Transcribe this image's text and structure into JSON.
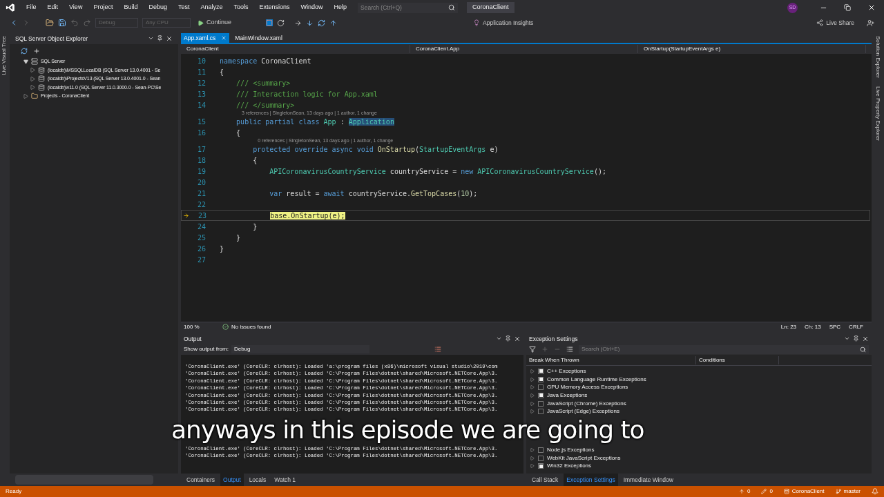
{
  "menu": [
    "File",
    "Edit",
    "View",
    "Project",
    "Build",
    "Debug",
    "Test",
    "Analyze",
    "Tools",
    "Extensions",
    "Window",
    "Help"
  ],
  "search": {
    "placeholder": "Search (Ctrl+Q)"
  },
  "solution_name": "CoronaClient",
  "avatar": "SD",
  "toolbar": {
    "configuration": "Debug",
    "platform": "Any CPU",
    "continue": "Continue",
    "insights": "Application Insights",
    "live_share": "Live Share"
  },
  "left_vertical_tab": "Live Visual Tree",
  "right_vertical_tabs": [
    "Solution Explorer",
    "Live Property Explorer"
  ],
  "sql_explorer": {
    "title": "SQL Server Object Explorer",
    "tree": [
      {
        "label": "SQL Server",
        "kind": "server",
        "expanded": true,
        "children": [
          {
            "label": "(localdb)\\MSSQLLocalDB (SQL Server 13.0.4001 - Se",
            "kind": "db",
            "expanded": false
          },
          {
            "label": "(localdb)\\ProjectsV13 (SQL Server 13.0.4001.0 - Sean",
            "kind": "db",
            "expanded": false
          },
          {
            "label": "(localdb)\\v11.0 (SQL Server 11.0.3000.0 - Sean-PC\\Se",
            "kind": "db",
            "expanded": false
          }
        ]
      },
      {
        "label": "Projects - CoronaClient",
        "kind": "folder",
        "expanded": false
      }
    ]
  },
  "editor_tabs": [
    {
      "label": "App.xaml.cs",
      "selected": true
    },
    {
      "label": "MainWindow.xaml",
      "selected": false
    }
  ],
  "nav_bar": [
    "CoronaClient",
    "CoronaClient.App",
    "OnStartup(StartupEventArgs e)"
  ],
  "code_lines": [
    {
      "number": "10",
      "tokens": [
        {
          "text": "namespace",
          "kind": "keyword"
        },
        {
          "text": " CoronaClient",
          "kind": "plain"
        }
      ]
    },
    {
      "number": "11",
      "tokens": [
        {
          "text": "{",
          "kind": "plain"
        }
      ]
    },
    {
      "number": "12",
      "tokens": [
        {
          "text": "    /// <summary>",
          "kind": "comment"
        }
      ]
    },
    {
      "number": "13",
      "tokens": [
        {
          "text": "    /// Interaction logic for App.xaml",
          "kind": "comment"
        }
      ]
    },
    {
      "number": "14",
      "tokens": [
        {
          "text": "    /// </summary>",
          "kind": "comment"
        }
      ]
    },
    {
      "number": "15",
      "lens": "3 references | SingletonSean, 13 days ago | 1 author, 1 change",
      "tokens": [
        {
          "text": "    public partial class",
          "kind": "keyword"
        },
        {
          "text": " App",
          "kind": "type"
        },
        {
          "text": " : ",
          "kind": "plain"
        },
        {
          "text": "Application",
          "kind": "type_highlight"
        }
      ]
    },
    {
      "number": "16",
      "tokens": [
        {
          "text": "    {",
          "kind": "plain"
        }
      ]
    },
    {
      "number": "17",
      "lens": "0 references | SingletonSean, 13 days ago | 1 author, 1 change",
      "tokens": [
        {
          "text": "        protected override async void",
          "kind": "keyword"
        },
        {
          "text": " OnStartup",
          "kind": "method"
        },
        {
          "text": "(",
          "kind": "plain"
        },
        {
          "text": "StartupEventArgs",
          "kind": "type"
        },
        {
          "text": " e)",
          "kind": "plain"
        }
      ]
    },
    {
      "number": "18",
      "tokens": [
        {
          "text": "        {",
          "kind": "plain"
        }
      ]
    },
    {
      "number": "19",
      "tokens": [
        {
          "text": "            APICoronavirusCountryService",
          "kind": "type"
        },
        {
          "text": " countryService = ",
          "kind": "plain"
        },
        {
          "text": "new",
          "kind": "keyword"
        },
        {
          "text": " APICoronavirusCountryService",
          "kind": "type"
        },
        {
          "text": "();",
          "kind": "plain"
        }
      ]
    },
    {
      "number": "20"
    },
    {
      "number": "21",
      "tokens": [
        {
          "text": "            var",
          "kind": "keyword"
        },
        {
          "text": " result = ",
          "kind": "plain"
        },
        {
          "text": "await",
          "kind": "keyword"
        },
        {
          "text": " countryService.",
          "kind": "plain"
        },
        {
          "text": "GetTopCases",
          "kind": "method"
        },
        {
          "text": "(",
          "kind": "plain"
        },
        {
          "text": "10",
          "kind": "number"
        },
        {
          "text": ");",
          "kind": "plain"
        }
      ]
    },
    {
      "number": "22"
    },
    {
      "number": "23",
      "current": true,
      "tokens": [
        {
          "text": "            base.OnStartup(e);",
          "kind": "current_statement"
        }
      ]
    },
    {
      "number": "24",
      "tokens": [
        {
          "text": "        }",
          "kind": "plain"
        }
      ]
    },
    {
      "number": "25",
      "tokens": [
        {
          "text": "    }",
          "kind": "plain"
        }
      ]
    },
    {
      "number": "26",
      "tokens": [
        {
          "text": "}",
          "kind": "plain"
        }
      ]
    },
    {
      "number": "27"
    }
  ],
  "editor_status": {
    "zoom": "100 %",
    "issues": "No issues found",
    "line": "Ln: 23",
    "column": "Ch: 13",
    "whitespace": "SPC",
    "line_ending": "CRLF"
  },
  "output": {
    "title": "Output",
    "source_label": "Show output from:",
    "source": "Debug",
    "lines_top": [
      "'CoronaClient.exe' (CoreCLR: clrhost): Loaded 'a:\\program files (x86)\\microsoft visual studio\\2019\\com",
      "'CoronaClient.exe' (CoreCLR: clrhost): Loaded 'C:\\Program Files\\dotnet\\shared\\Microsoft.NETCore.App\\3.",
      "'CoronaClient.exe' (CoreCLR: clrhost): Loaded 'C:\\Program Files\\dotnet\\shared\\Microsoft.NETCore.App\\3.",
      "'CoronaClient.exe' (CoreCLR: clrhost): Loaded 'C:\\Program Files\\dotnet\\shared\\Microsoft.NETCore.App\\3.",
      "'CoronaClient.exe' (CoreCLR: clrhost): Loaded 'C:\\Program Files\\dotnet\\shared\\Microsoft.NETCore.App\\3.",
      "'CoronaClient.exe' (CoreCLR: clrhost): Loaded 'C:\\Program Files\\dotnet\\shared\\Microsoft.NETCore.App\\3.",
      "'CoronaClient.exe' (CoreCLR: clrhost): Loaded 'C:\\Program Files\\dotnet\\shared\\Microsoft.NETCore.App\\3."
    ],
    "lines_bottom": [
      "'CoronaClient.exe' (CoreCLR: clrhost): Loaded 'C:\\Program Files\\dotnet\\shared\\Microsoft.NETCore.App\\3.",
      "'CoronaClient.exe' (CoreCLR: clrhost): Loaded 'C:\\Program Files\\dotnet\\shared\\Microsoft.NETCore.App\\3."
    ]
  },
  "bottom_tabs_left": [
    {
      "label": "Containers",
      "selected": false
    },
    {
      "label": "Output",
      "selected": true
    },
    {
      "label": "Locals",
      "selected": false
    },
    {
      "label": "Watch 1",
      "selected": false
    }
  ],
  "exceptions": {
    "title": "Exception Settings",
    "search_placeholder": "Search (Ctrl+E)",
    "columns": [
      "Break When Thrown",
      "Conditions"
    ],
    "rows_top": [
      {
        "label": "C++ Exceptions",
        "checked": true
      },
      {
        "label": "Common Language Runtime Exceptions",
        "checked": true
      },
      {
        "label": "GPU Memory Access Exceptions",
        "checked": false
      },
      {
        "label": "Java Exceptions",
        "checked": true
      },
      {
        "label": "JavaScript (Chrome) Exceptions",
        "checked": false
      },
      {
        "label": "JavaScript (Edge) Exceptions",
        "checked": false
      }
    ],
    "rows_bottom": [
      {
        "label": "Node.js Exceptions",
        "checked": false
      },
      {
        "label": "WebKit JavaScript Exceptions",
        "checked": false
      },
      {
        "label": "Win32 Exceptions",
        "checked": true
      }
    ]
  },
  "bottom_tabs_right": [
    {
      "label": "Call Stack",
      "selected": false
    },
    {
      "label": "Exception Settings",
      "selected": true
    },
    {
      "label": "Immediate Window",
      "selected": false
    }
  ],
  "status_bar": {
    "state": "Ready",
    "pushes": "0",
    "changes": "0",
    "repo": "CoronaClient",
    "branch": "master"
  },
  "subtitle": "anyways in this episode we are going to"
}
